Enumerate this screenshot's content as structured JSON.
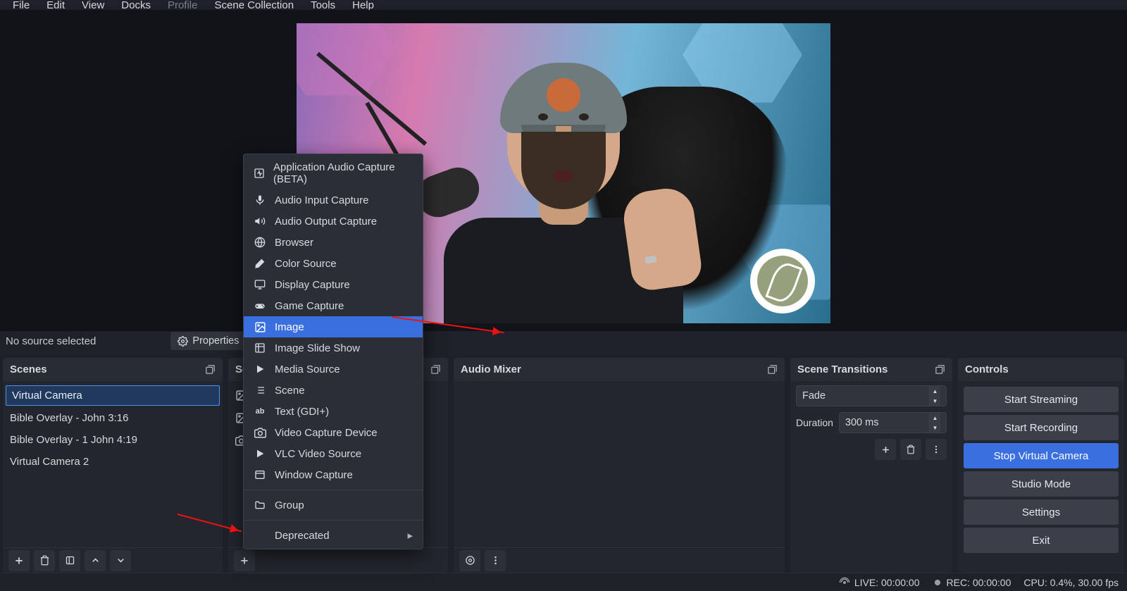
{
  "menubar": {
    "items": [
      "File",
      "Edit",
      "View",
      "Docks",
      "Profile",
      "Scene Collection",
      "Tools",
      "Help"
    ],
    "active_index": 4
  },
  "srcbar": {
    "none_selected": "No source selected",
    "properties": "Properties"
  },
  "docks": {
    "scenes": {
      "title": "Scenes",
      "items": [
        "Virtual Camera",
        "Bible Overlay - John 3:16",
        "Bible Overlay - 1 John 4:19",
        "Virtual Camera 2"
      ],
      "selected_index": 0
    },
    "sources": {
      "title": "Sources",
      "items": [
        {
          "icon": "image-icon"
        },
        {
          "icon": "image-icon"
        },
        {
          "icon": "camera-icon"
        }
      ]
    },
    "mixer": {
      "title": "Audio Mixer"
    },
    "transitions": {
      "title": "Scene Transitions",
      "current": "Fade",
      "duration_label": "Duration",
      "duration_value": "300 ms"
    },
    "controls": {
      "title": "Controls",
      "buttons": {
        "start_streaming": "Start Streaming",
        "start_recording": "Start Recording",
        "stop_virtual_camera": "Stop Virtual Camera",
        "studio_mode": "Studio Mode",
        "settings": "Settings",
        "exit": "Exit"
      },
      "primary_index": 2
    }
  },
  "context_menu": {
    "items": [
      {
        "icon": "app-audio-icon",
        "label": "Application Audio Capture (BETA)"
      },
      {
        "icon": "mic-icon",
        "label": "Audio Input Capture"
      },
      {
        "icon": "speaker-icon",
        "label": "Audio Output Capture"
      },
      {
        "icon": "globe-icon",
        "label": "Browser"
      },
      {
        "icon": "brush-icon",
        "label": "Color Source"
      },
      {
        "icon": "monitor-icon",
        "label": "Display Capture"
      },
      {
        "icon": "gamepad-icon",
        "label": "Game Capture"
      },
      {
        "icon": "image-icon",
        "label": "Image"
      },
      {
        "icon": "slideshow-icon",
        "label": "Image Slide Show"
      },
      {
        "icon": "play-icon",
        "label": "Media Source"
      },
      {
        "icon": "list-icon",
        "label": "Scene"
      },
      {
        "icon": "text-icon",
        "label": "Text (GDI+)"
      },
      {
        "icon": "camera-icon",
        "label": "Video Capture Device"
      },
      {
        "icon": "play-icon",
        "label": "VLC Video Source"
      },
      {
        "icon": "window-icon",
        "label": "Window Capture"
      }
    ],
    "group_label": "Group",
    "deprecated_label": "Deprecated",
    "highlight_index": 7
  },
  "status": {
    "live": "LIVE: 00:00:00",
    "rec": "REC: 00:00:00",
    "cpu": "CPU: 0.4%, 30.00 fps"
  },
  "colors": {
    "accent": "#3a6fe0"
  }
}
